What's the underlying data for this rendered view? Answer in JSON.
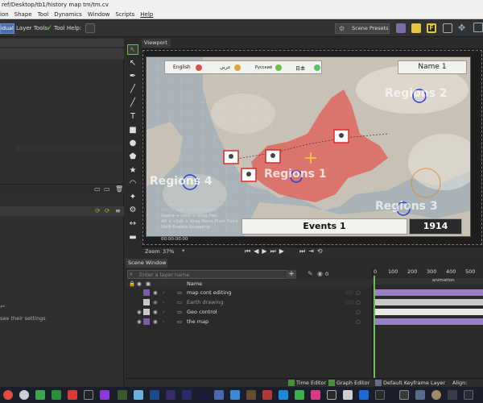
{
  "window": {
    "title": "ref/Desktop/tb1/history map tm/tm.cv"
  },
  "menu": [
    "ion",
    "Shape",
    "Tool",
    "Dynamics",
    "Window",
    "Scripts",
    "Help"
  ],
  "toolbar": {
    "mode_label": "idual",
    "layer_tools_label": "Layer Tools:",
    "tool_help_label": "Tool Help:",
    "scene_presets_label": "Scene Presets"
  },
  "viewport": {
    "tab_label": "Viewport",
    "legend": [
      {
        "label": "English",
        "color": "#d9534f"
      },
      {
        "label": "عربي",
        "color": "#e0a43a"
      },
      {
        "label": "Русский",
        "color": "#6cc04a"
      },
      {
        "label": "日本",
        "color": "#58c46a"
      }
    ],
    "name_box": "Name 1",
    "regions": [
      "Regions 1",
      "Regions 2",
      "Regions 3",
      "Regions 4"
    ],
    "events_label": "Events 1",
    "year": "1914",
    "hints": [
      "Ctrl + click + drag Rotate",
      "Space + click + drag Pan",
      "Alt + click + drag Move Pivot Point",
      "Shift Enable Snapping"
    ],
    "timecode": "00:00:00:00",
    "zoom_label": "Zoom",
    "zoom_value": "37%"
  },
  "scene": {
    "tab_label": "Scene Window",
    "search_placeholder": "Enter a layer name",
    "count": "0",
    "column_name": "Name",
    "layers": [
      {
        "name": "map cont editing",
        "color": "#7a5ca8",
        "dim": false
      },
      {
        "name": "Earth drawing",
        "color": "#c9c9c9",
        "dim": true
      },
      {
        "name": "Geo control",
        "color": "#c9c9c9",
        "dim": false
      },
      {
        "name": "the map",
        "color": "#7a5ca8",
        "dim": false
      }
    ]
  },
  "timeline": {
    "frame_start": "0",
    "ticks": [
      "100",
      "200",
      "300",
      "400",
      "500"
    ],
    "animation_label": "animation",
    "bars": [
      "#9b7fc4",
      "#c9c9c9",
      "#e8e8e8",
      "#9b7fc4"
    ]
  },
  "footer": {
    "time_editor": "Time Editor",
    "graph_editor": "Graph Editor",
    "keyframe_layer": "Default Keyframe Layer",
    "align_label": "Align:"
  },
  "left_panel": {
    "settings_hint": "see their settings"
  }
}
